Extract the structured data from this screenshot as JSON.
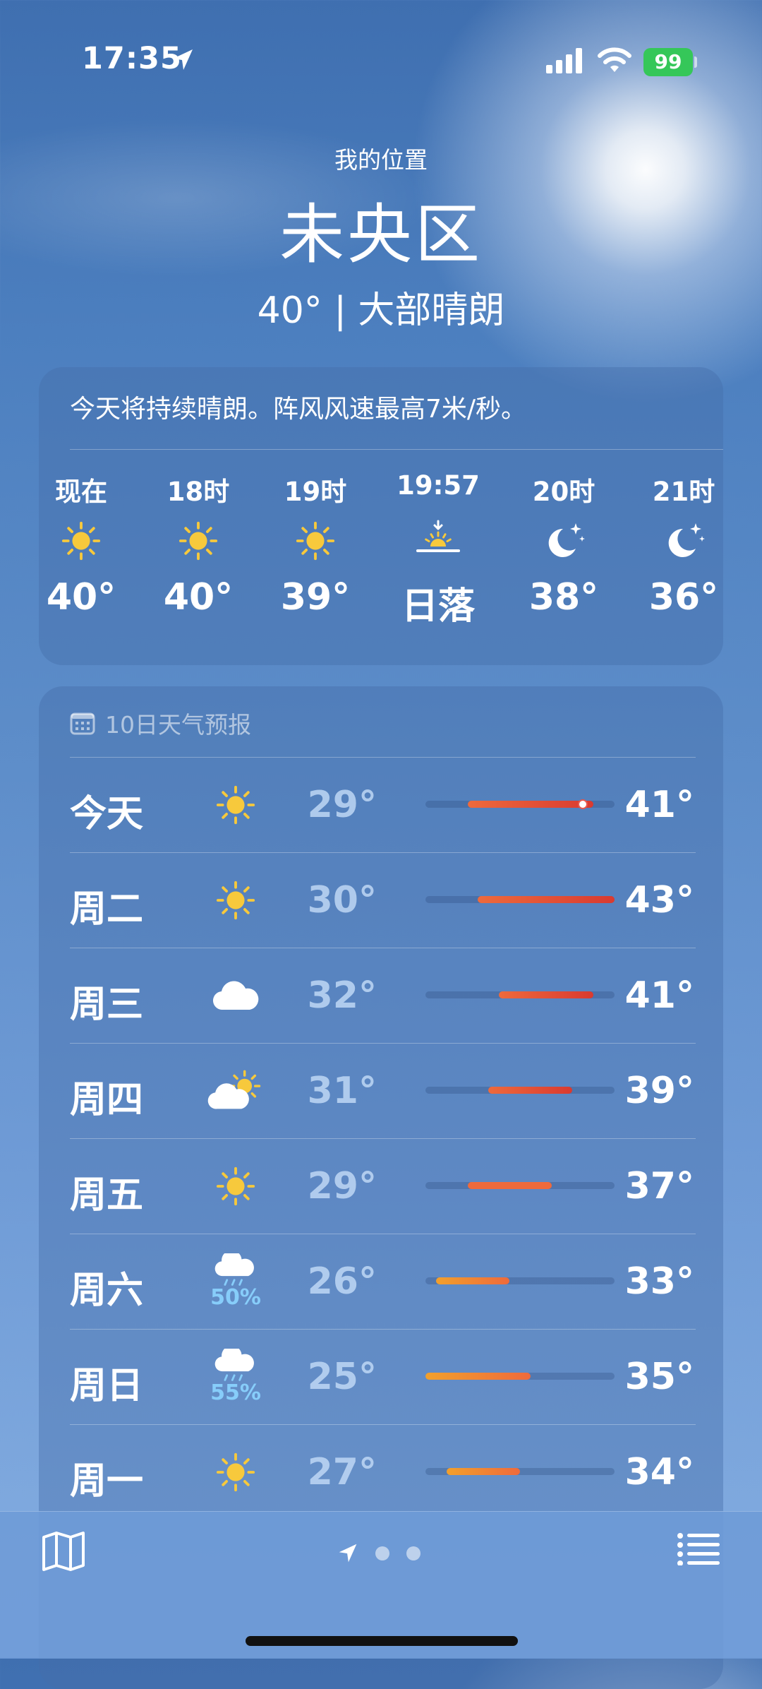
{
  "status_bar": {
    "time": "17:35",
    "battery": "99",
    "icons": [
      "location-arrow-icon",
      "signal-icon",
      "wifi-icon",
      "battery-charging-icon"
    ]
  },
  "header": {
    "my_location": "我的位置",
    "city": "未央区",
    "summary": "40° | 大部晴朗"
  },
  "hourly": {
    "description": "今天将持续晴朗。阵风风速最高7米/秒。",
    "items": [
      {
        "label": "现在",
        "icon": "sun-icon",
        "value": "40°"
      },
      {
        "label": "18时",
        "icon": "sun-icon",
        "value": "40°"
      },
      {
        "label": "19时",
        "icon": "sun-icon",
        "value": "39°"
      },
      {
        "label": "19:57",
        "icon": "sunset-icon",
        "value": "日落"
      },
      {
        "label": "20时",
        "icon": "moon-stars-icon",
        "value": "38°"
      },
      {
        "label": "21时",
        "icon": "moon-stars-icon",
        "value": "36°"
      }
    ]
  },
  "daily": {
    "title": "10日天气预报",
    "range": [
      25,
      43
    ],
    "days": [
      {
        "name": "今天",
        "icon": "sun-icon",
        "precip": "",
        "low": "29°",
        "high": "41°",
        "low_value": 29,
        "high_value": 41,
        "current": 40
      },
      {
        "name": "周二",
        "icon": "sun-icon",
        "precip": "",
        "low": "30°",
        "high": "43°",
        "low_value": 30,
        "high_value": 43
      },
      {
        "name": "周三",
        "icon": "cloud-icon",
        "precip": "",
        "low": "32°",
        "high": "41°",
        "low_value": 32,
        "high_value": 41
      },
      {
        "name": "周四",
        "icon": "partly-cloudy-icon",
        "precip": "",
        "low": "31°",
        "high": "39°",
        "low_value": 31,
        "high_value": 39
      },
      {
        "name": "周五",
        "icon": "sun-icon",
        "precip": "",
        "low": "29°",
        "high": "37°",
        "low_value": 29,
        "high_value": 37
      },
      {
        "name": "周六",
        "icon": "rain-icon",
        "precip": "50%",
        "low": "26°",
        "high": "33°",
        "low_value": 26,
        "high_value": 33
      },
      {
        "name": "周日",
        "icon": "rain-icon",
        "precip": "55%",
        "low": "25°",
        "high": "35°",
        "low_value": 25,
        "high_value": 35
      },
      {
        "name": "周一",
        "icon": "sun-icon",
        "precip": "",
        "low": "27°",
        "high": "34°",
        "low_value": 27,
        "high_value": 34
      }
    ]
  },
  "colors": {
    "bar_cool": "#f2a02c",
    "bar_warm": "#ee6a3c",
    "bar_hot": "#d93a30",
    "sun": "#f7c93c",
    "precip": "#87cdfa"
  }
}
